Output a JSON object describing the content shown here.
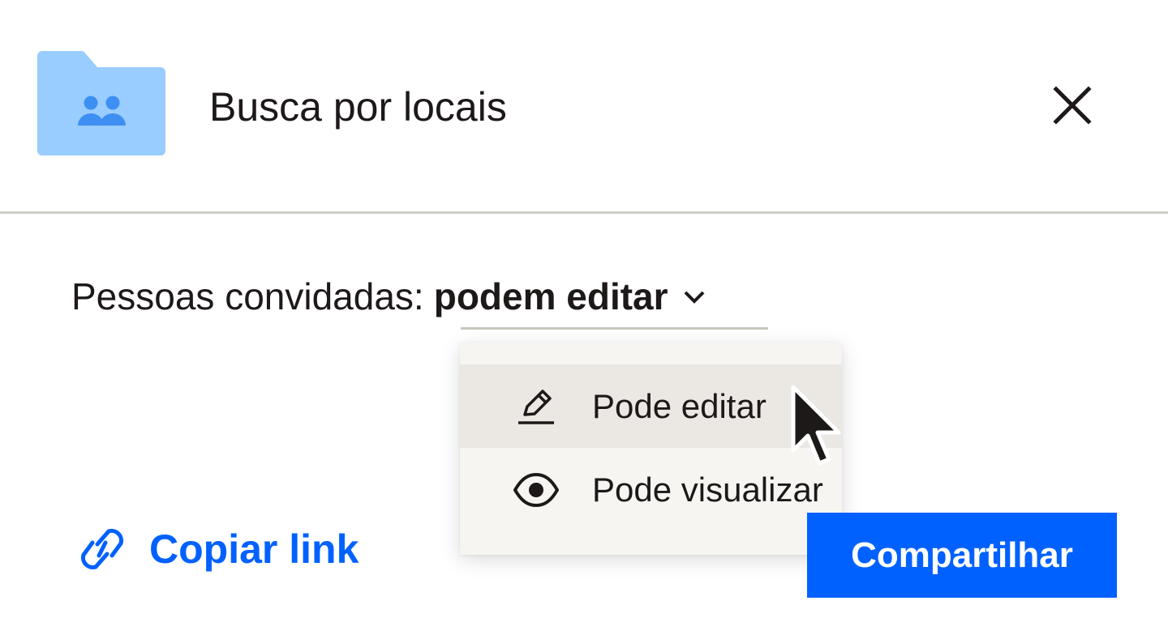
{
  "header": {
    "folder_icon": "shared-folder-icon",
    "title": "Busca por locais",
    "close_icon": "close-icon"
  },
  "permissions": {
    "label": "Pessoas convidadas:",
    "selected": "podem editar",
    "chevron_icon": "chevron-down-icon"
  },
  "menu": {
    "items": [
      {
        "icon": "pencil-icon",
        "label": "Pode editar",
        "highlighted": true
      },
      {
        "icon": "eye-icon",
        "label": "Pode visualizar",
        "highlighted": false
      }
    ]
  },
  "footer": {
    "copy_link_icon": "link-icon",
    "copy_link_label": "Copiar link",
    "share_label": "Compartilhar"
  },
  "colors": {
    "accent": "#0061fe",
    "folder": "#99ccff",
    "folder_people": "#3d8ff2",
    "menu_bg": "#f7f5f2",
    "menu_highlight": "#ebe8e3",
    "divider": "#d0cec8",
    "text": "#1e1919"
  },
  "mouse_cursor": "arrow-cursor-icon"
}
